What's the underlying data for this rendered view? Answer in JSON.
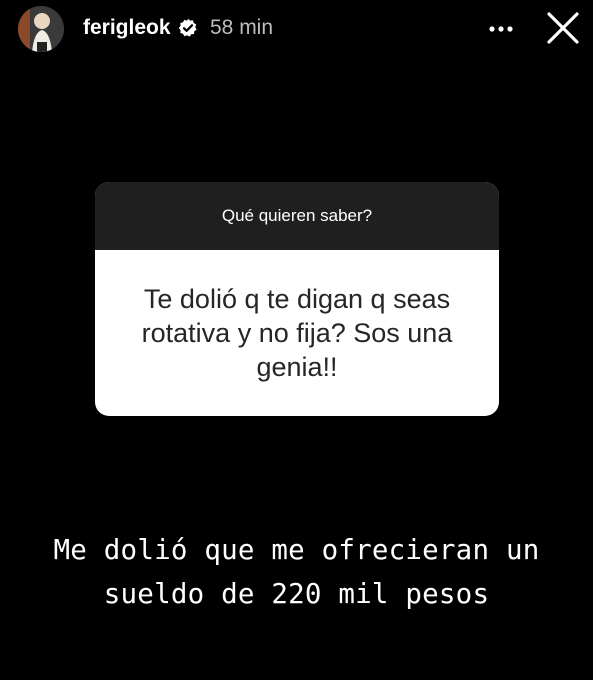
{
  "header": {
    "username": "ferigleok",
    "timestamp": "58 min",
    "icons": {
      "avatar": "profile-avatar",
      "verified": "verified-badge-icon",
      "more": "more-options-icon",
      "close": "close-icon"
    }
  },
  "question_sticker": {
    "prompt": "Qué quieren saber?",
    "question": "Te dolió q te digan q seas rotativa y no fija? Sos una genia!!"
  },
  "answer": {
    "text": "Me dolió que me ofrecieran un sueldo de 220 mil pesos"
  },
  "colors": {
    "background": "#000000",
    "sticker_header": "#1f1f1f",
    "sticker_body": "#ffffff",
    "text_primary": "#ffffff",
    "text_secondary": "#bdbdbd"
  }
}
